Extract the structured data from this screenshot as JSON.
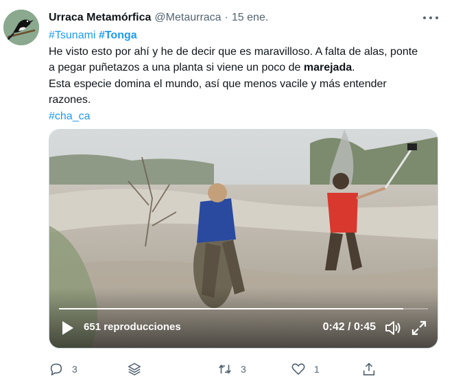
{
  "tweet": {
    "display_name": "Urraca Metamórfica",
    "handle": "@Metaurraca",
    "separator": "·",
    "time": "15 ene.",
    "avatar_icon": "magpie-bird-avatar",
    "more_icon": "more-dots-icon",
    "body": {
      "hashtag_1": "#Tsunami",
      "hashtag_2": "#Tonga",
      "line2_part1": "He visto esto por ahí y he de decir que es maravilloso. A falta de alas, ponte",
      "line3_part1": "a pegar puñetazos a una planta si viene un poco de ",
      "line3_bold": "marejada",
      "line3_part2": ".",
      "line4": "Esta especie domina el mundo, así que menos vacile y más entender",
      "line5": "razones.",
      "hashtag_3": "#cha_ca"
    },
    "video": {
      "views": "651 reproducciones",
      "timecode": "0:42 / 0:45",
      "progress": 0.933,
      "play_icon": "play-icon",
      "volume_icon": "volume-icon",
      "fullscreen_icon": "fullscreen-icon"
    },
    "actions": {
      "reply_count": "3",
      "retweet_count": "3",
      "like_count": "1"
    },
    "colors": {
      "link": "#1d9bf0",
      "secondary_text": "#536471",
      "primary_text": "#0f1419"
    }
  }
}
